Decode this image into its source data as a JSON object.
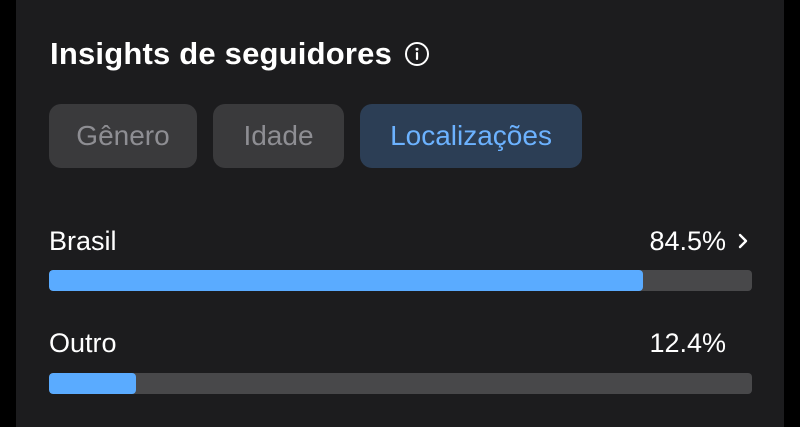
{
  "card": {
    "title": "Insights de seguidores",
    "info_icon": "info-circle-icon"
  },
  "tabs": [
    {
      "label": "Gênero",
      "active": false
    },
    {
      "label": "Idade",
      "active": false
    },
    {
      "label": "Localizações",
      "active": true
    }
  ],
  "locations": [
    {
      "label": "Brasil",
      "value": "84.5%",
      "fraction": 0.845,
      "has_chevron": true
    },
    {
      "label": "Outro",
      "value": "12.4%",
      "fraction": 0.124,
      "has_chevron": false
    }
  ],
  "colors": {
    "background": "#1c1c1e",
    "accent": "#5aabff",
    "track": "#48484a",
    "active_tab_bg": "#2c3e55",
    "active_tab_text": "#6cb2ff"
  }
}
